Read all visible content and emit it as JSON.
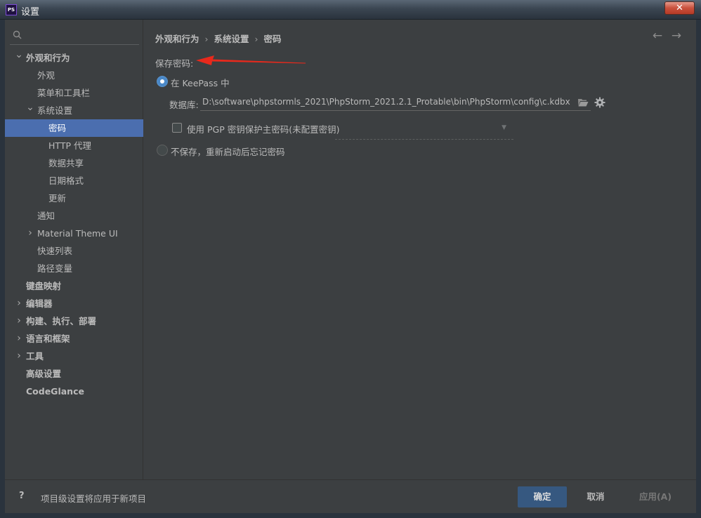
{
  "window": {
    "app_badge": "PS",
    "title": "设置",
    "close_glyph": "✕"
  },
  "sidebar": {
    "search_placeholder": "",
    "items": [
      {
        "label": "外观和行为",
        "level": 0,
        "expanded": true,
        "bold": true
      },
      {
        "label": "外观",
        "level": 1
      },
      {
        "label": "菜单和工具栏",
        "level": 1
      },
      {
        "label": "系统设置",
        "level": 1,
        "expanded": true
      },
      {
        "label": "密码",
        "level": 2,
        "selected": true
      },
      {
        "label": "HTTP 代理",
        "level": 2
      },
      {
        "label": "数据共享",
        "level": 2
      },
      {
        "label": "日期格式",
        "level": 2
      },
      {
        "label": "更新",
        "level": 2
      },
      {
        "label": "通知",
        "level": 1
      },
      {
        "label": "Material Theme UI",
        "level": 1,
        "collapsed": true
      },
      {
        "label": "快速列表",
        "level": 1
      },
      {
        "label": "路径变量",
        "level": 1
      },
      {
        "label": "键盘映射",
        "level": 0,
        "bold": true
      },
      {
        "label": "编辑器",
        "level": 0,
        "collapsed": true,
        "bold": true
      },
      {
        "label": "构建、执行、部署",
        "level": 0,
        "collapsed": true,
        "bold": true
      },
      {
        "label": "语言和框架",
        "level": 0,
        "collapsed": true,
        "bold": true
      },
      {
        "label": "工具",
        "level": 0,
        "collapsed": true,
        "bold": true
      },
      {
        "label": "高级设置",
        "level": 0,
        "bold": true
      },
      {
        "label": "CodeGlance",
        "level": 0,
        "bold": true
      }
    ]
  },
  "breadcrumb": {
    "part1": "外观和行为",
    "part2": "系统设置",
    "part3": "密码",
    "separator": "›"
  },
  "nav": {
    "back": "←",
    "forward": "→"
  },
  "password": {
    "section_label": "保存密码:",
    "option_keepass": "在 KeePass 中",
    "database_label": "数据库:",
    "database_path": "D:\\software\\phpstormls_2021\\PhpStorm_2021.2.1_Protable\\bin\\PhpStorm\\config\\c.kdbx",
    "pgp_checkbox_label": "使用 PGP 密钥保护主密码(未配置密钥)",
    "pgp_checked": false,
    "option_no_save": "不保存，重新启动后忘记密码",
    "selected_option": "keepass"
  },
  "footer": {
    "help": "?",
    "note": "项目级设置将应用于新项目",
    "ok": "确定",
    "cancel": "取消",
    "apply": "应用(A)"
  },
  "colors": {
    "selection": "#4b6eaf",
    "primary_button": "#365880",
    "annotation_arrow": "#e8291c"
  }
}
